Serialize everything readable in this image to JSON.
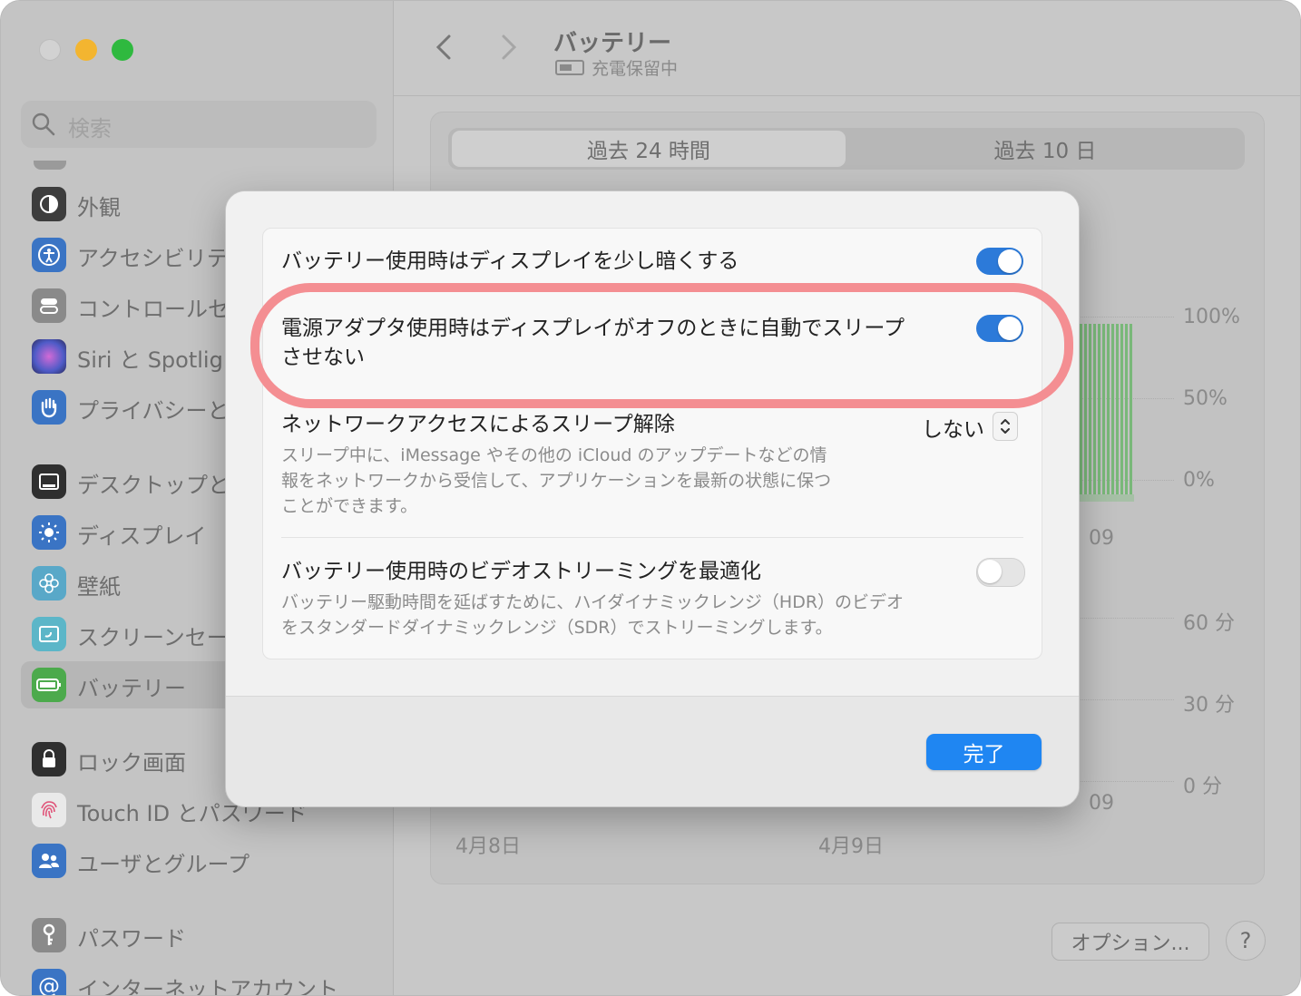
{
  "sidebar": {
    "search_placeholder": "検索",
    "items": [
      {
        "label": "外観",
        "icon": "appearance-icon",
        "color": "#3d3d3d"
      },
      {
        "label": "アクセシビリテ",
        "icon": "accessibility-icon",
        "color": "#3a74c4"
      },
      {
        "label": "コントロールセ",
        "icon": "control-center-icon",
        "color": "#8a8a8a"
      },
      {
        "label": "Siri と Spotligh",
        "icon": "siri-icon",
        "color": "#5a4b9a"
      },
      {
        "label": "プライバシーと",
        "icon": "privacy-hand-icon",
        "color": "#3a74c4"
      },
      {
        "label": "デスクトップと",
        "icon": "desktop-dock-icon",
        "color": "#2f2f2f"
      },
      {
        "label": "ディスプレイ",
        "icon": "display-sun-icon",
        "color": "#3a74c4"
      },
      {
        "label": "壁紙",
        "icon": "wallpaper-flower-icon",
        "color": "#59a8c8"
      },
      {
        "label": "スクリーンセー",
        "icon": "screensaver-icon",
        "color": "#5cb6c8"
      },
      {
        "label": "バッテリー",
        "icon": "battery-icon",
        "color": "#4caa4c"
      },
      {
        "label": "ロック画面",
        "icon": "lock-icon",
        "color": "#2f2f2f"
      },
      {
        "label": "Touch ID とパスワード",
        "icon": "fingerprint-icon",
        "color": "#e9e9e9"
      },
      {
        "label": "ユーザとグループ",
        "icon": "users-icon",
        "color": "#3a74c4"
      },
      {
        "label": "パスワード",
        "icon": "key-icon",
        "color": "#8a8a8a"
      },
      {
        "label": "インターネットアカウント",
        "icon": "at-sign-icon",
        "color": "#3a74c4"
      }
    ]
  },
  "window": {
    "title": "バッテリー",
    "subtitle": "充電保留中",
    "tabs": [
      "過去 24 時間",
      "過去 10 日"
    ],
    "chart_labels": {
      "percent": [
        "100%",
        "50%",
        "0%"
      ],
      "minutes": [
        "60 分",
        "30 分",
        "0 分"
      ],
      "time_tick": "09",
      "dates": [
        "4月8日",
        "4月9日"
      ]
    },
    "options_label": "オプション...",
    "help_label": "?"
  },
  "modal": {
    "rows": [
      {
        "title": "バッテリー使用時はディスプレイを少し暗くする",
        "toggle": true
      },
      {
        "title_line1": "電源アダプタ使用時はディスプレイがオフのときに自動でスリープ",
        "title_line2": "させない",
        "toggle": true
      },
      {
        "title": "ネットワークアクセスによるスリープ解除",
        "value": "しない",
        "desc_lines": [
          "スリープ中に、iMessage やその他の iCloud のアップデートなどの情",
          "報をネットワークから受信して、アプリケーションを最新の状態に保つ",
          "ことができます。"
        ]
      },
      {
        "title": "バッテリー使用時のビデオストリーミングを最適化",
        "toggle": false,
        "desc_lines": [
          "バッテリー駆動時間を延ばすために、ハイダイナミックレンジ（HDR）のビデオ",
          "をスタンダードダイナミックレンジ（SDR）でストリーミングします。"
        ]
      }
    ],
    "done_label": "完了"
  },
  "colors": {
    "accent": "#1f86f2",
    "toggle_on": "#2c7ad9",
    "highlight": "#f48e92"
  }
}
